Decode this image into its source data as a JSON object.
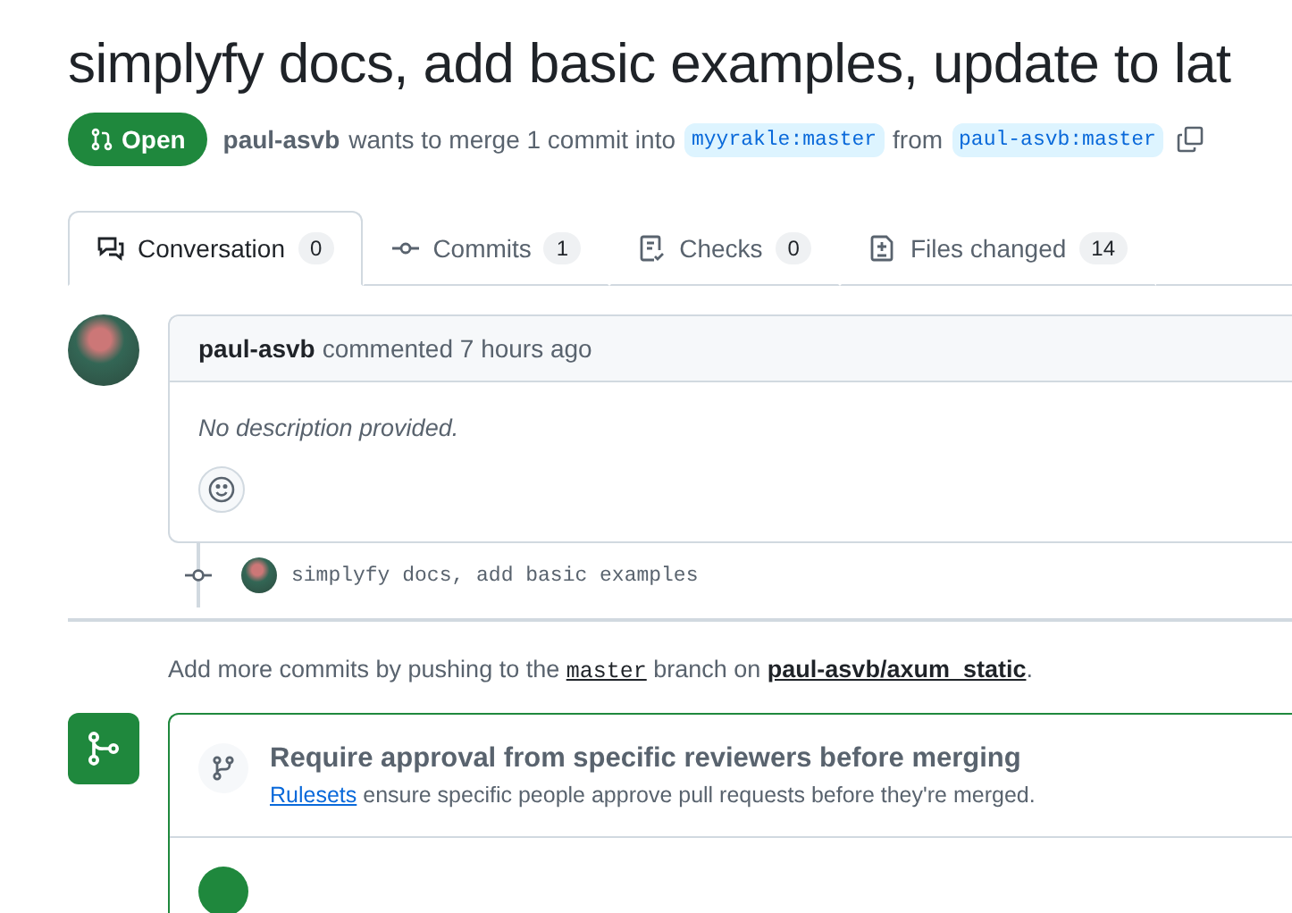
{
  "title": "simplyfy docs, add basic examples, update to lat",
  "status": {
    "label": "Open",
    "author": "paul-asvb",
    "text_before": "wants to merge 1 commit into",
    "base": "myyrakle:master",
    "text_middle": "from",
    "head": "paul-asvb:master"
  },
  "tabs": [
    {
      "kind": "conversation",
      "label": "Conversation",
      "count": "0",
      "selected": true
    },
    {
      "kind": "commits",
      "label": "Commits",
      "count": "1",
      "selected": false
    },
    {
      "kind": "checks",
      "label": "Checks",
      "count": "0",
      "selected": false
    },
    {
      "kind": "files",
      "label": "Files changed",
      "count": "14",
      "selected": false
    }
  ],
  "comment": {
    "author": "paul-asvb",
    "meta": "commented 7 hours ago",
    "body": "No description provided."
  },
  "commits": [
    {
      "message": "simplyfy docs, add basic examples"
    }
  ],
  "push_hint": {
    "before": "Add more commits by pushing to the",
    "branch": "master",
    "middle": "branch on",
    "repo": "paul-asvb/axum_static",
    "after": "."
  },
  "merge_box": {
    "title": "Require approval from specific reviewers before merging",
    "link": "Rulesets",
    "text": "ensure specific people approve pull requests before they're merged."
  }
}
